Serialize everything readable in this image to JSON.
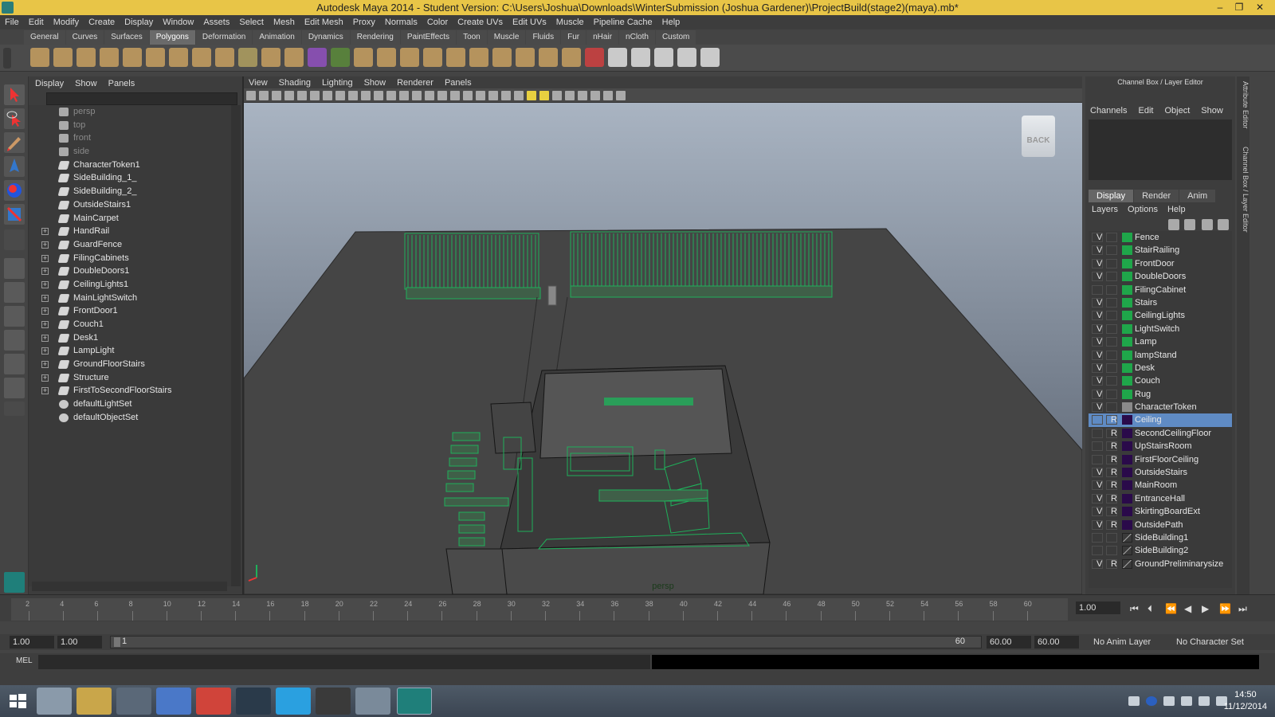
{
  "window": {
    "title": "Autodesk Maya 2014 - Student Version: C:\\Users\\Joshua\\Downloads\\WinterSubmission (Joshua Gardener)\\ProjectBuild(stage2)(maya).mb*",
    "minimize": "–",
    "maximize": "❐",
    "close": "✕"
  },
  "menubar": [
    "File",
    "Edit",
    "Modify",
    "Create",
    "Display",
    "Window",
    "Assets",
    "Select",
    "Mesh",
    "Edit Mesh",
    "Proxy",
    "Normals",
    "Color",
    "Create UVs",
    "Edit UVs",
    "Muscle",
    "Pipeline Cache",
    "Help"
  ],
  "shelf_tabs": [
    "General",
    "Curves",
    "Surfaces",
    "Polygons",
    "Deformation",
    "Animation",
    "Dynamics",
    "Rendering",
    "PaintEffects",
    "Toon",
    "Muscle",
    "Fluids",
    "Fur",
    "nHair",
    "nCloth",
    "Custom"
  ],
  "shelf_active": "Polygons",
  "outliner": {
    "menu": [
      "Display",
      "Show",
      "Panels"
    ],
    "items": [
      {
        "label": "persp",
        "kind": "camera",
        "dim": true
      },
      {
        "label": "top",
        "kind": "camera",
        "dim": true
      },
      {
        "label": "front",
        "kind": "camera",
        "dim": true
      },
      {
        "label": "side",
        "kind": "camera",
        "dim": true
      },
      {
        "label": "CharacterToken1",
        "kind": "mesh"
      },
      {
        "label": "SideBuilding_1_",
        "kind": "mesh"
      },
      {
        "label": "SideBuilding_2_",
        "kind": "mesh"
      },
      {
        "label": "OutsideStairs1",
        "kind": "mesh"
      },
      {
        "label": "MainCarpet",
        "kind": "mesh"
      },
      {
        "label": "HandRail",
        "kind": "group",
        "expand": "+"
      },
      {
        "label": "GuardFence",
        "kind": "group",
        "expand": "+"
      },
      {
        "label": "FilingCabinets",
        "kind": "group",
        "expand": "+"
      },
      {
        "label": "DoubleDoors1",
        "kind": "group",
        "expand": "+"
      },
      {
        "label": "CeilingLights1",
        "kind": "group",
        "expand": "+"
      },
      {
        "label": "MainLightSwitch",
        "kind": "group",
        "expand": "+"
      },
      {
        "label": "FrontDoor1",
        "kind": "group",
        "expand": "+"
      },
      {
        "label": "Couch1",
        "kind": "group",
        "expand": "+"
      },
      {
        "label": "Desk1",
        "kind": "group",
        "expand": "+"
      },
      {
        "label": "LampLight",
        "kind": "group",
        "expand": "+"
      },
      {
        "label": "GroundFloorStairs",
        "kind": "group",
        "expand": "+"
      },
      {
        "label": "Structure",
        "kind": "group",
        "expand": "+"
      },
      {
        "label": "FirstToSecondFloorStairs",
        "kind": "group",
        "expand": "+"
      },
      {
        "label": "defaultLightSet",
        "kind": "set"
      },
      {
        "label": "defaultObjectSet",
        "kind": "set"
      }
    ]
  },
  "viewport": {
    "menu": [
      "View",
      "Shading",
      "Lighting",
      "Show",
      "Renderer",
      "Panels"
    ],
    "camera_label": "persp",
    "viewcube_label": "BACK"
  },
  "channel_box": {
    "title": "Channel Box / Layer Editor",
    "menu": [
      "Channels",
      "Edit",
      "Object",
      "Show"
    ],
    "layer_tabs": [
      "Display",
      "Render",
      "Anim"
    ],
    "layer_active_tab": "Display",
    "layer_menu": [
      "Layers",
      "Options",
      "Help"
    ],
    "layers": [
      {
        "v": "V",
        "r": "",
        "name": "Fence",
        "color": "#1fa64a"
      },
      {
        "v": "V",
        "r": "",
        "name": "StairRailing",
        "color": "#1fa64a"
      },
      {
        "v": "V",
        "r": "",
        "name": "FrontDoor",
        "color": "#1fa64a"
      },
      {
        "v": "V",
        "r": "",
        "name": "DoubleDoors",
        "color": "#1fa64a"
      },
      {
        "v": "",
        "r": "",
        "name": "FilingCabinet",
        "color": "#1fa64a"
      },
      {
        "v": "V",
        "r": "",
        "name": "Stairs",
        "color": "#1fa64a"
      },
      {
        "v": "V",
        "r": "",
        "name": "CeilingLights",
        "color": "#1fa64a"
      },
      {
        "v": "V",
        "r": "",
        "name": "LightSwitch",
        "color": "#1fa64a"
      },
      {
        "v": "V",
        "r": "",
        "name": "Lamp",
        "color": "#1fa64a"
      },
      {
        "v": "V",
        "r": "",
        "name": "lampStand",
        "color": "#1fa64a"
      },
      {
        "v": "V",
        "r": "",
        "name": "Desk",
        "color": "#1fa64a"
      },
      {
        "v": "V",
        "r": "",
        "name": "Couch",
        "color": "#1fa64a"
      },
      {
        "v": "V",
        "r": "",
        "name": "Rug",
        "color": "#1fa64a"
      },
      {
        "v": "V",
        "r": "",
        "name": "CharacterToken",
        "color": "#8a8a8a"
      },
      {
        "v": "",
        "r": "R",
        "name": "Ceiling",
        "color": "#2a0a4a",
        "selected": true
      },
      {
        "v": "",
        "r": "R",
        "name": "SecondCeilingFloor",
        "color": "#2a0a4a"
      },
      {
        "v": "",
        "r": "R",
        "name": "UpStairsRoom",
        "color": "#2a0a4a"
      },
      {
        "v": "",
        "r": "R",
        "name": "FirstFloorCeiling",
        "color": "#2a0a4a"
      },
      {
        "v": "V",
        "r": "R",
        "name": "OutsideStairs",
        "color": "#2a0a4a"
      },
      {
        "v": "V",
        "r": "R",
        "name": "MainRoom",
        "color": "#2a0a4a"
      },
      {
        "v": "V",
        "r": "R",
        "name": "EntranceHall",
        "color": "#2a0a4a"
      },
      {
        "v": "V",
        "r": "R",
        "name": "SkirtingBoardExt",
        "color": "#2a0a4a"
      },
      {
        "v": "V",
        "r": "R",
        "name": "OutsidePath",
        "color": "#2a0a4a"
      },
      {
        "v": "",
        "r": "",
        "name": "SideBuilding1",
        "color": "none"
      },
      {
        "v": "",
        "r": "",
        "name": "SideBuilding2",
        "color": "none"
      },
      {
        "v": "V",
        "r": "R",
        "name": "GroundPreliminarysize",
        "color": "none"
      }
    ]
  },
  "side_tabs": [
    "Attribute Editor",
    "Channel Box / Layer Editor"
  ],
  "timeline": {
    "ticks": [
      "2",
      "4",
      "6",
      "8",
      "10",
      "12",
      "14",
      "16",
      "18",
      "20",
      "22",
      "24",
      "26",
      "28",
      "30",
      "32",
      "34",
      "36",
      "38",
      "40",
      "42",
      "44",
      "46",
      "48",
      "50",
      "52",
      "54",
      "56",
      "58",
      "60"
    ],
    "current_frame": "1.00"
  },
  "range": {
    "start_time": "1.00",
    "playback_start": "1.00",
    "slider_start": "1",
    "slider_end": "60",
    "playback_end": "60.00",
    "end_time": "60.00",
    "anim_layer": "No Anim Layer",
    "character_set": "No Character Set"
  },
  "command_line": {
    "label": "MEL"
  },
  "clock": {
    "time": "14:50",
    "date": "11/12/2014"
  }
}
